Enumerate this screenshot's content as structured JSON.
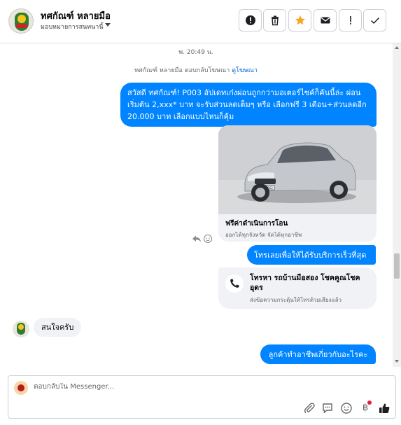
{
  "header": {
    "name": "ทศกัณฑ์ หลายมือ",
    "assign_label": "มอบหมายการสนทนานี้",
    "buttons": [
      {
        "name": "mark-spam-button",
        "icon": "exclamation-circle-icon"
      },
      {
        "name": "delete-button",
        "icon": "trash-icon"
      },
      {
        "name": "star-button",
        "icon": "star-icon"
      },
      {
        "name": "mark-unread-button",
        "icon": "envelope-icon"
      },
      {
        "name": "follow-up-button",
        "icon": "exclamation-icon"
      },
      {
        "name": "mark-done-button",
        "icon": "check-icon"
      }
    ],
    "star_color": "#f5a623"
  },
  "chat": {
    "timestamp": "พ. 20:49 น.",
    "reply_note": "ทศกัณฑ์ หลายมือ ตอบกลับโฆษณา",
    "reply_link": "ดูโฆษณา",
    "ad_message": "สวัสดี ทศกัณฑ์! P003 อัปเดทเก๋งผ่อนถูกกว่ามอเตอร์ไซค์ก็คันนี้ล่ะ ผ่อนเริ่มต้น 2,xxx* บาท จะรับส่วนลดเต็มๆ หรือ เลือกฟรี 3 เดือน+ส่วนลดอีก 20.000 บาท เลือกแบบไหนก็คุ้ม",
    "card_title": "ฟรีค่าดำเนินการโอน",
    "card_subtitle": "ออกได้ทุกจังหวัด จัดได้ทุกอาชีพ",
    "car_plate": "7กพ 4562",
    "cta_button": "โทรเลยเพื่อให้ได้รับบริการเร็วที่สุด",
    "call_title": "โทรหา รถบ้านมือสอง โชคคูณโชคอุดร",
    "call_subtitle": "ส่งข้อความกระตุ้นให้โทรด้วยเสียงแล้ว",
    "incoming_message": "สนใจครับ",
    "last_message": "ลูกค้าทำอาชีพเกี่ยวกับอะไรคะ"
  },
  "composer": {
    "placeholder": "ตอบกลับใน Messenger...",
    "tools": [
      "attachment-icon",
      "saved-reply-icon",
      "emoji-icon",
      "baht-icon",
      "thumbs-up-icon"
    ],
    "baht_symbol": "฿"
  },
  "colors": {
    "messenger_blue": "#0084ff",
    "link_blue": "#0064d1",
    "bubble_gray": "#f0f2f5"
  }
}
